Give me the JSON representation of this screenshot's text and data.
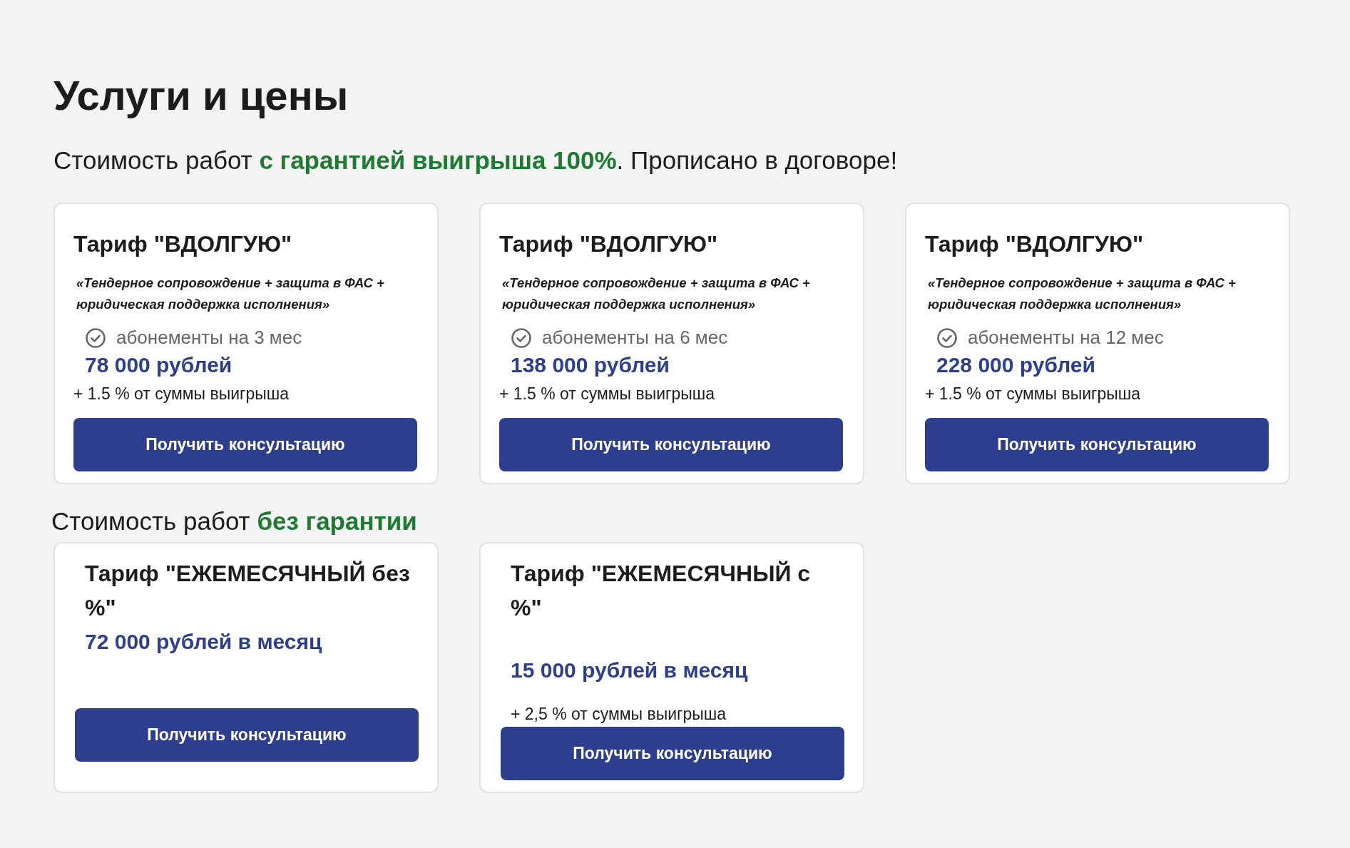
{
  "page": {
    "title": "Услуги и цены",
    "subtitle": "Стоимость работ **с гарантией выигрыша 100%**. Прописано в договоре!"
  },
  "guaranteed_plans": [
    {
      "kind": "subscription",
      "title": "Тариф \"ВДОЛГУЮ\"",
      "description": "«Тендерное сопровождение + защита в ФАС + юридическая поддержка исполнения»",
      "term": "абонементы на 3 мес",
      "price": "78 000 рублей",
      "extra": "+ 1.5 % от суммы выигрыша",
      "button": "Получить консультацию"
    },
    {
      "kind": "subscription",
      "title": "Тариф \"ВДОЛГУЮ\"",
      "description": "«Тендерное сопровождение + защита в ФАС + юридическая поддержка исполнения»",
      "term": "абонементы на 6 мес",
      "price": "138 000 рублей",
      "extra": "+ 1.5 % от суммы выигрыша",
      "button": "Получить консультацию"
    },
    {
      "kind": "subscription",
      "title": "Тариф \"ВДОЛГУЮ\"",
      "description": "«Тендерное сопровождение + защита в ФАС + юридическая поддержка исполнения»",
      "term": "абонементы на 12 мес",
      "price": "228 000 рублей",
      "extra": "+ 1.5 % от суммы выигрыша",
      "button": "Получить консультацию"
    }
  ],
  "no_guarantee_heading": "Стоимость работ **без гарантии**",
  "plans_without_guarantee": [
    {
      "kind": "monthly",
      "title": "Тариф \"ЕЖЕМЕСЯЧНЫЙ без %\"",
      "price": "72 000 рублей в месяц",
      "button": "Получить консультацию"
    },
    {
      "kind": "monthly",
      "title": "Тариф \"ЕЖЕМЕСЯЧНЫЙ с %\"",
      "price": "15 000 рублей в месяц",
      "extra": "+ 2,5 % от суммы выигрыша",
      "button": "Получить консультацию"
    }
  ]
}
